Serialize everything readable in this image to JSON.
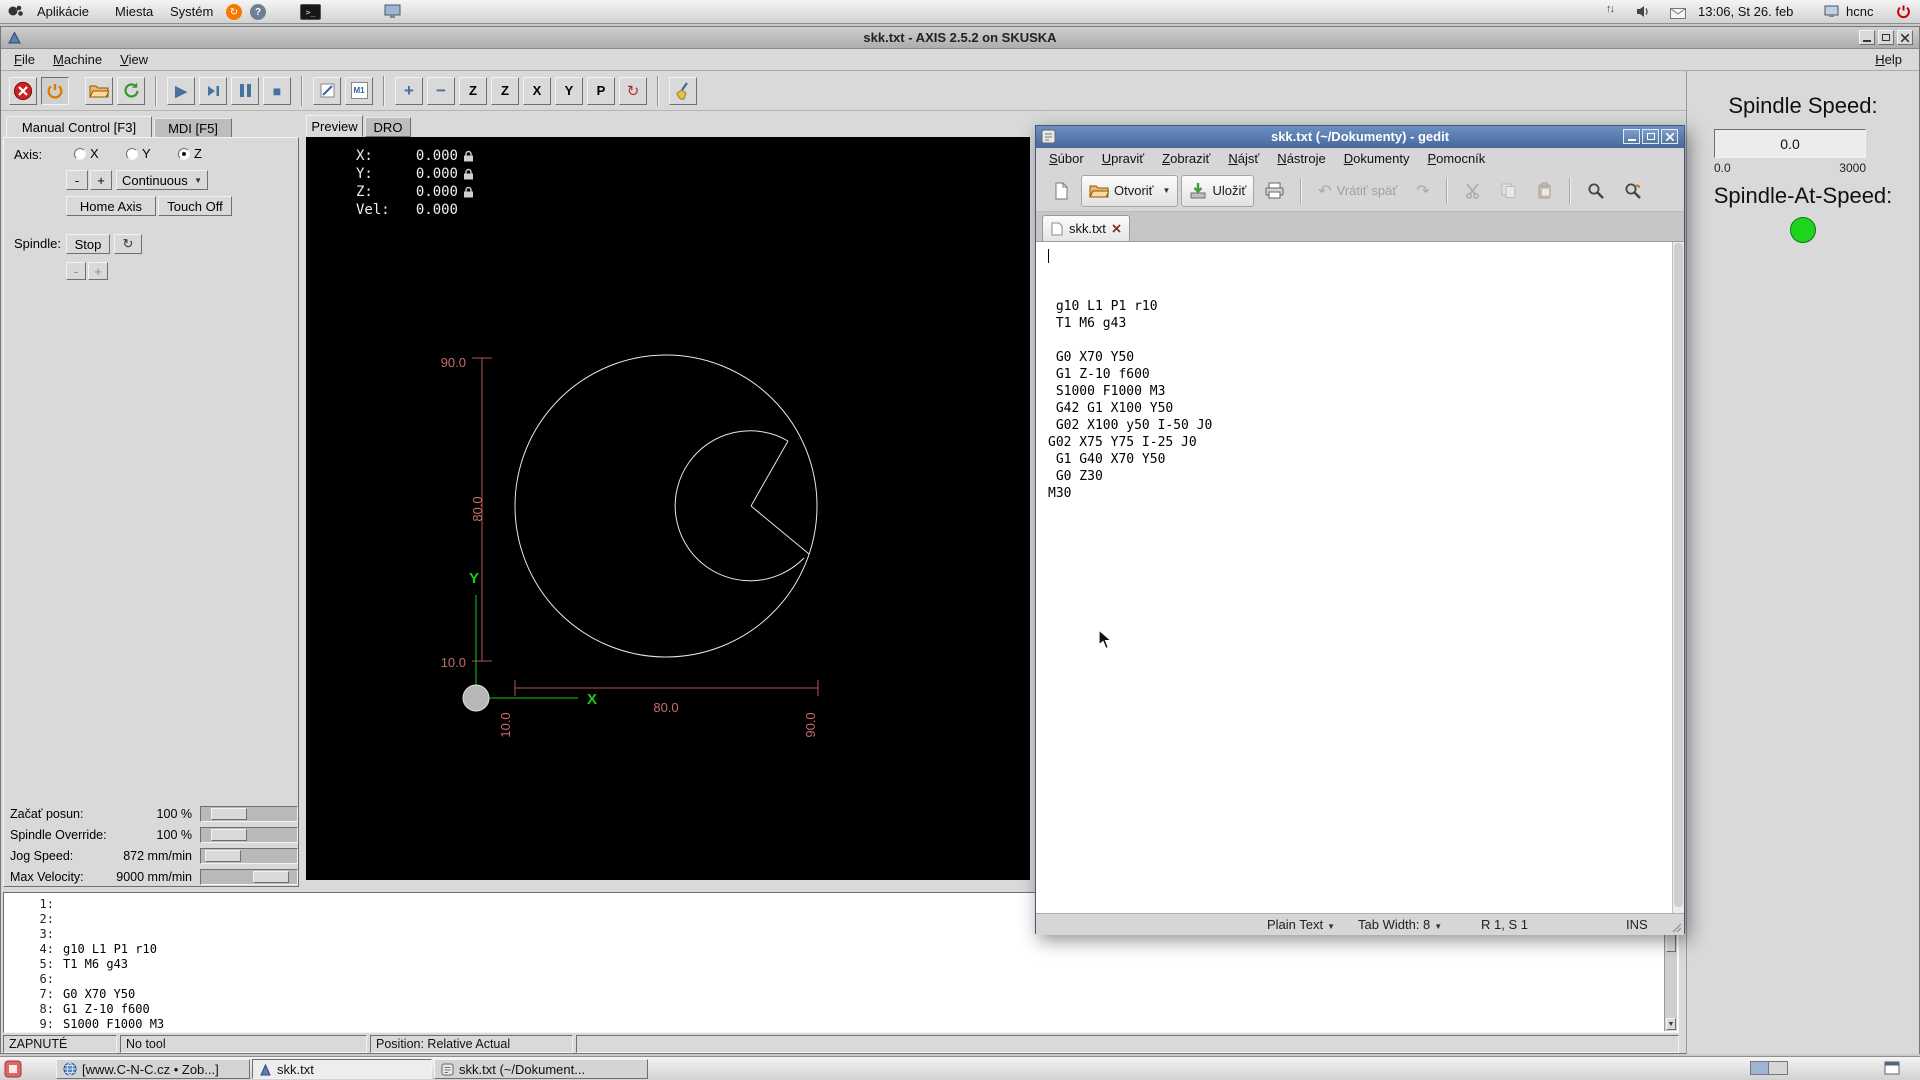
{
  "icons": {
    "dropdown": "▼",
    "play": "▶",
    "stop": "■",
    "zoom_in": "+",
    "zoom_out": "−",
    "view_z": "Z",
    "view_z2": "Z",
    "view_x": "X",
    "view_y": "Y",
    "view_p": "P",
    "rotate": "↻",
    "spindle_turn": "↻",
    "undo": "↶",
    "redo": "↷",
    "net_up": "↑",
    "net_down": "↓",
    "help": "?",
    "terminal": "&gt;_",
    "m1": "M1"
  },
  "top_panel": {
    "menu_applications": "Aplikácie",
    "menu_places": "Miesta",
    "menu_system": "Systém",
    "clock": "13:06, St 26. feb",
    "user": "hcnc"
  },
  "axis": {
    "title": "skk.txt - AXIS 2.5.2 on SKUSKA",
    "menu_file": "File",
    "menu_machine": "Machine",
    "menu_view": "View",
    "menu_help": "Help",
    "tab_manual": "Manual Control [F3]",
    "tab_mdi": "MDI [F5]",
    "axis_label": "Axis:",
    "axis_x": "X",
    "axis_y": "Y",
    "axis_z": "Z",
    "jog_minus": "-",
    "jog_plus": "+",
    "jog_mode": "Continuous",
    "home_axis": "Home Axis",
    "touch_off": "Touch Off",
    "spindle_label": "Spindle:",
    "spindle_stop": "Stop",
    "spindle_minus": "-",
    "spindle_plus": "+",
    "ovr": [
      {
        "label": "Začať posun:",
        "value": "100 %"
      },
      {
        "label": "Spindle Override:",
        "value": "100 %"
      },
      {
        "label": "Jog Speed:",
        "value": "872 mm/min"
      },
      {
        "label": "Max Velocity:",
        "value": "9000 mm/min"
      }
    ],
    "tab_preview": "Preview",
    "tab_dro": "DRO",
    "dro": [
      {
        "label": "X:",
        "value": "0.000"
      },
      {
        "label": "Y:",
        "value": "0.000"
      },
      {
        "label": "Z:",
        "value": "0.000"
      },
      {
        "label": "Vel:",
        "value": "0.000"
      }
    ],
    "dims": {
      "left_top": "90.0",
      "left_mid": "80.0",
      "left_bottom": "10.0",
      "bottom_left": "10.0",
      "bottom_mid": "80.0",
      "bottom_right": "90.0",
      "x_axis": "X",
      "y_axis": "Y"
    },
    "listing": [
      {
        "n": "1:",
        "t": ""
      },
      {
        "n": "2:",
        "t": ""
      },
      {
        "n": "3:",
        "t": ""
      },
      {
        "n": "4:",
        "t": "g10 L1 P1 r10"
      },
      {
        "n": "5:",
        "t": "T1 M6 g43"
      },
      {
        "n": "6:",
        "t": ""
      },
      {
        "n": "7:",
        "t": "G0 X70 Y50"
      },
      {
        "n": "8:",
        "t": "G1 Z-10 f600"
      },
      {
        "n": "9:",
        "t": "S1000 F1000 M3"
      }
    ],
    "status_power": "ZAPNUTÉ",
    "status_tool": "No tool",
    "status_position": "Position: Relative Actual"
  },
  "pyvcp": {
    "speed_label": "Spindle Speed:",
    "speed_value": "0.0",
    "scale_min": "0.0",
    "scale_max": "3000",
    "at_speed_label": "Spindle-At-Speed:",
    "led_color": "#1ed41e"
  },
  "gedit": {
    "title": "skk.txt (~/Dokumenty) - gedit",
    "menus": [
      "Súbor",
      "Upraviť",
      "Zobraziť",
      "Nájsť",
      "Nástroje",
      "Dokumenty",
      "Pomocník"
    ],
    "toolbar": {
      "open": "Otvoriť",
      "save": "Uložiť",
      "undo": "Vrátiť späť"
    },
    "tab_label": "skk.txt",
    "lines": [
      "",
      "",
      "",
      " g10 L1 P1 r10",
      " T1 M6 g43",
      "",
      " G0 X70 Y50",
      " G1 Z-10 f600",
      " S1000 F1000 M3",
      " G42 G1 X100 Y50",
      " G02 X100 y50 I-50 J0",
      "G02 X75 Y75 I-25 J0",
      " G1 G40 X70 Y50",
      " G0 Z30",
      "M30"
    ],
    "status": {
      "language": "Plain Text",
      "tab_width": "Tab Width: 8",
      "cursor": "R 1, S 1",
      "mode": "INS"
    }
  },
  "taskbar": {
    "buttons": [
      {
        "label": "[www.C-N-C.cz • Zob...]"
      },
      {
        "label": "skk.txt"
      },
      {
        "label": "skk.txt (~/Dokument..."
      }
    ]
  }
}
